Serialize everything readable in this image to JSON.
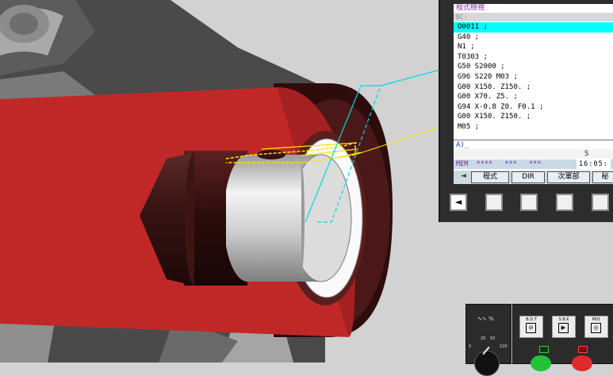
{
  "screen": {
    "title": "程式檢視",
    "sub_header": "BC:",
    "program_lines": [
      "O0011 ;",
      "G40 ;",
      "N1 ;",
      "T0303 ;",
      "G50 S2000 ;",
      "G96 S220 M03 ;",
      "G00 X150. Z150. ;",
      "G00 X70. Z5. ;",
      "G94 X-0.8 Z0. F0.1 ;",
      "G00 X150. Z150. ;",
      "M05 ;"
    ],
    "current_line_index": 0,
    "prompt": "A)_",
    "spindle_label": "S",
    "mode": "MEM",
    "status_fields": "****   ***   ***",
    "time": "16:05:"
  },
  "softkeys": {
    "left_arrow": "◄",
    "keys": [
      "程式",
      "DIR",
      "次軍部",
      "秘"
    ]
  },
  "hardware_keys": {
    "left_arrow": "◄"
  },
  "dial": {
    "icon": "feed-override-icon",
    "symbol": "∿∿ %",
    "marks": [
      "20",
      "50",
      "0",
      "100"
    ]
  },
  "operator_buttons": [
    {
      "label": "B.D.T",
      "icon": "block-delete-icon"
    },
    {
      "label": "S.B.K",
      "icon": "single-block-icon"
    },
    {
      "label": "M01",
      "icon": "optional-stop-icon"
    }
  ],
  "colors": {
    "accent_cyan": "#00ffff",
    "part_red": "#c02828",
    "title_purple": "#8a2aa0"
  }
}
